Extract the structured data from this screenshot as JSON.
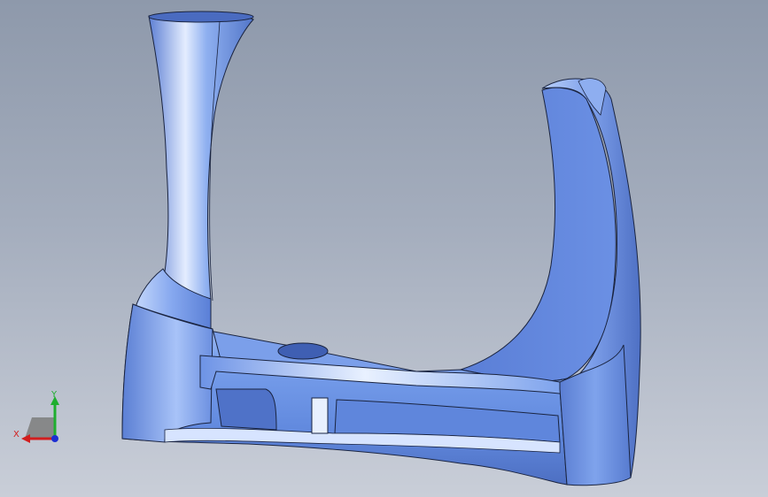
{
  "viewport": {
    "background_top": "#8e99ab",
    "background_bottom": "#c9ced8"
  },
  "model": {
    "name": "part-model",
    "surface_color": "#6f93e3",
    "highlight_color": "#d9e6ff",
    "edge_color": "#1a2440"
  },
  "triad": {
    "x_label": "X",
    "y_label": "Y",
    "x_color": "#d21d1d",
    "y_color": "#1fae2f",
    "z_color": "#1d2fd2",
    "plane_color": "#7d7d7d"
  }
}
